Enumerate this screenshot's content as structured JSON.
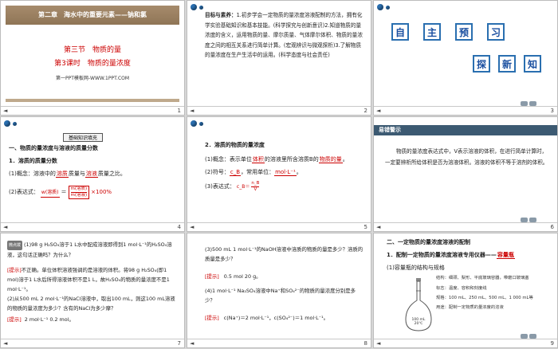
{
  "slides": [
    {
      "num": "1",
      "chapter": "第二章　海水中的重要元素——钠和氯",
      "section": "第三节　物质的量",
      "lesson": "第3课时　物质的量浓度",
      "site": "第一PPT模板网-WWW.1PPT.COM"
    },
    {
      "num": "2",
      "goal_label": "目标与素养：",
      "goal_text": "1.初步学会一定物质的量浓度溶液配制的方法，拥有化学实验基础知识和基本技能。(科学探究与创新意识)2.知道物质的量浓度的含义，运用物质的量、摩尔质量、气体摩尔体积、物质的量浓度之间的相互关系进行简单计算。(宏观辨识与微观探析)3.了解物质的量浓度在生产生活中的运用。(科学态度与社会责任)"
    },
    {
      "num": "3",
      "chars1": [
        "自",
        "主",
        "预",
        "习"
      ],
      "chars2": [
        "探",
        "新",
        "知"
      ]
    },
    {
      "num": "4",
      "badge": "基础知识填充",
      "h1": "一、物质的量浓度与溶液的质量分数",
      "h2": "1．溶质的质量分数",
      "p1a": "(1)概念：溶液中的",
      "p1b": "溶质",
      "p1c": "质量与",
      "p1d": "溶液",
      "p1e": "质量之比。",
      "p2a": "(2)表达式：",
      "p2b": "w(溶质)",
      "p2c": "＝",
      "p2d": "m(溶质)",
      "p2e": "m(溶液)",
      "p2f": "×100%"
    },
    {
      "num": "5",
      "h": "2．溶质的物质的量浓度",
      "p1a": "(1)概念：表示单位",
      "p1b": "体积",
      "p1c": "的溶液里所含溶质B的",
      "p1d": "物质的量",
      "p1e": "。",
      "p2a": "(2)符号：",
      "p2b": "c_B",
      "p2c": "，常用单位：",
      "p2d": "mol·L⁻¹",
      "p2e": "。",
      "p3a": "(3)表达式：",
      "p3b": "c_B＝",
      "p3c": "n_B",
      "p3d": "V"
    },
    {
      "num": "6",
      "title": "易错警示",
      "text": "物质的量浓度表达式中，V表示溶液的体积，在进行简单计算时，一定要辨析所给体积是否为溶液体积。溶液的体积不等于溶剂的体积。"
    },
    {
      "num": "7",
      "badge": "微点拨",
      "q1": "(1)98 g H₂SO₄溶于1 L水中配成溶液即得到1 mol·L⁻¹的H₂SO₄溶液，这句话正确吗？为什么？",
      "tip_label": "[提示]",
      "a1": "不正确。单位体积溶液强调的是溶液的体积。将98 g H₂SO₄(即1 mol)溶于1 L水后所得溶液体积不是1 L，故H₂SO₄的物质的量浓度不是1 mol·L⁻¹。",
      "q2": "(2)从500 mL 2 mol·L⁻¹的NaCl溶液中，取出100 mL，则这100 mL溶液的物质的量浓度为多少？含有的NaCl为多少摩？",
      "a2": "2 mol·L⁻¹ 0.2 mol。"
    },
    {
      "num": "8",
      "q3": "(3)500 mL 1 mol·L⁻¹的NaOH溶液中溶质的物质的量是多少？溶质的质量是多少？",
      "tip_label": "[提示]",
      "a3": "0.5 mol 20 g。",
      "q4": "(4)1 mol·L⁻¹ Na₂SO₄溶液中Na⁺和SO₄²⁻的物质的量浓度分别是多少？",
      "a4": "c(Na⁺)＝2 mol·L⁻¹，c(SO₄²⁻)＝1 mol·L⁻¹。"
    },
    {
      "num": "9",
      "h1": "二、一定物质的量浓度溶液的配制",
      "h2a": "1．配制一定物质的量浓度溶液专用仪器——",
      "h2b": "容量瓶",
      "h3": "(1)容量瓶的结构与规格",
      "flask_label": "100 mL 20℃",
      "ann1": "结构：细颈、梨形、平底玻璃容器，带磨口玻璃塞",
      "ann2": "标志：温度、容积和刻度线",
      "ann3": "规格：100 mL、250 mL、500 mL、1 000 mL等",
      "ann4": "用途：配制一定物质的量浓度的溶液"
    }
  ],
  "colors": {
    "accent_red": "#c00000",
    "brown": "#a5886a",
    "nav_blue": "#2a6fb0"
  }
}
